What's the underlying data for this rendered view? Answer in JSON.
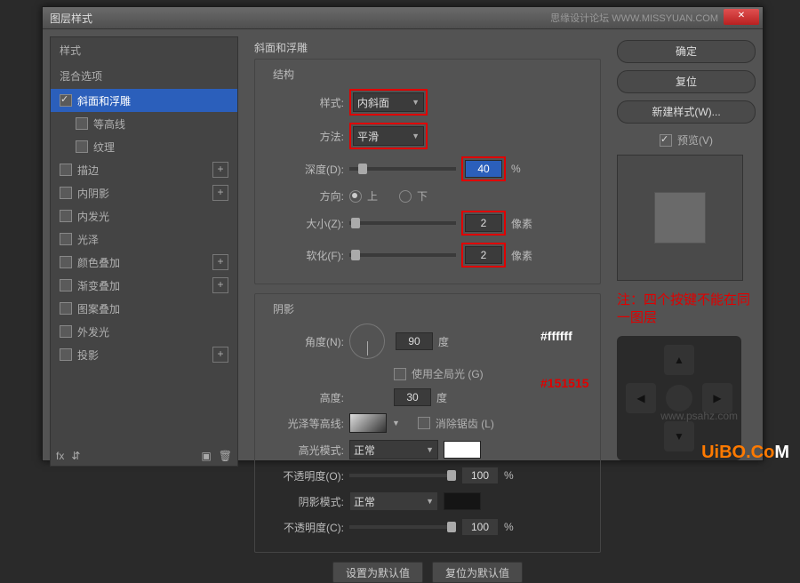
{
  "title": "图层样式",
  "watermark_top": "思缘设计论坛  WWW.MISSYUAN.COM",
  "left": {
    "header": "样式",
    "blend": "混合选项",
    "items": [
      {
        "label": "斜面和浮雕",
        "checked": true,
        "selected": true,
        "indent": false,
        "plus": false
      },
      {
        "label": "等高线",
        "checked": false,
        "selected": false,
        "indent": true,
        "plus": false
      },
      {
        "label": "纹理",
        "checked": false,
        "selected": false,
        "indent": true,
        "plus": false
      },
      {
        "label": "描边",
        "checked": false,
        "selected": false,
        "indent": false,
        "plus": true
      },
      {
        "label": "内阴影",
        "checked": false,
        "selected": false,
        "indent": false,
        "plus": true
      },
      {
        "label": "内发光",
        "checked": false,
        "selected": false,
        "indent": false,
        "plus": false
      },
      {
        "label": "光泽",
        "checked": false,
        "selected": false,
        "indent": false,
        "plus": false
      },
      {
        "label": "颜色叠加",
        "checked": false,
        "selected": false,
        "indent": false,
        "plus": true
      },
      {
        "label": "渐变叠加",
        "checked": false,
        "selected": false,
        "indent": false,
        "plus": true
      },
      {
        "label": "图案叠加",
        "checked": false,
        "selected": false,
        "indent": false,
        "plus": false
      },
      {
        "label": "外发光",
        "checked": false,
        "selected": false,
        "indent": false,
        "plus": false
      },
      {
        "label": "投影",
        "checked": false,
        "selected": false,
        "indent": false,
        "plus": true
      }
    ],
    "footer_fx": "fx"
  },
  "mid": {
    "title": "斜面和浮雕",
    "struct_title": "结构",
    "style_lbl": "样式:",
    "style_val": "内斜面",
    "method_lbl": "方法:",
    "method_val": "平滑",
    "depth_lbl": "深度(D):",
    "depth_val": "40",
    "depth_unit": "%",
    "dir_lbl": "方向:",
    "dir_up": "上",
    "dir_down": "下",
    "size_lbl": "大小(Z):",
    "size_val": "2",
    "size_unit": "像素",
    "soften_lbl": "软化(F):",
    "soften_val": "2",
    "soften_unit": "像素",
    "shade_title": "阴影",
    "angle_lbl": "角度(N):",
    "angle_val": "90",
    "deg": "度",
    "global_lbl": "使用全局光 (G)",
    "alt_lbl": "高度:",
    "alt_val": "30",
    "gloss_lbl": "光泽等高线:",
    "aa_lbl": "消除锯齿 (L)",
    "hmode_lbl": "高光模式:",
    "hmode_val": "正常",
    "hop_lbl": "不透明度(O):",
    "hop_val": "100",
    "pct": "%",
    "smode_lbl": "阴影模式:",
    "smode_val": "正常",
    "sop_lbl": "不透明度(C):",
    "sop_val": "100",
    "btn_default": "设置为默认值",
    "btn_reset": "复位为默认值"
  },
  "right": {
    "ok": "确定",
    "reset": "复位",
    "newstyle": "新建样式(W)...",
    "preview": "预览(V)",
    "note": "注：四个按键不能在同一图层"
  },
  "annot": {
    "white": "#ffffff",
    "dark": "#151515"
  },
  "colors": {
    "highlight": "#ffffff",
    "shadow": "#151515"
  },
  "uibo": "UiBO.C",
  "uibo_m": "M",
  "wm_center": "www.psahz.com"
}
